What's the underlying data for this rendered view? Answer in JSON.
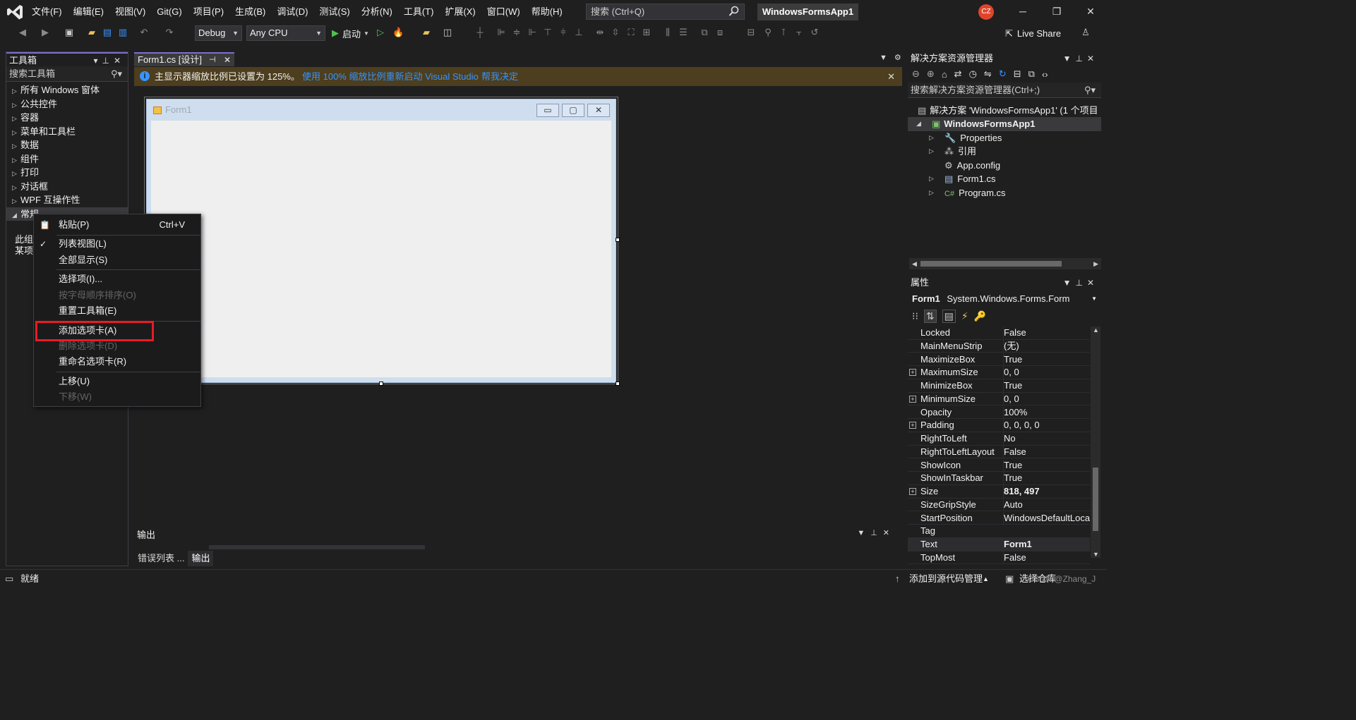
{
  "window": {
    "menu": [
      "文件(F)",
      "编辑(E)",
      "视图(V)",
      "Git(G)",
      "项目(P)",
      "生成(B)",
      "调试(D)",
      "测试(S)",
      "分析(N)",
      "工具(T)",
      "扩展(X)",
      "窗口(W)",
      "帮助(H)"
    ],
    "search_placeholder": "搜索 (Ctrl+Q)",
    "solution_name": "WindowsFormsApp1",
    "avatar": "CZ"
  },
  "toolbar": {
    "config": "Debug",
    "platform": "Any CPU",
    "start": "启动",
    "live_share": "Live Share"
  },
  "toolbox": {
    "title": "工具箱",
    "search": "搜索工具箱",
    "groups": [
      "所有 Windows 窗体",
      "公共控件",
      "容器",
      "菜单和工具栏",
      "数据",
      "组件",
      "打印",
      "对话框",
      "WPF 互操作性",
      "常规"
    ],
    "empty_line1": "此组",
    "empty_line2": "某项"
  },
  "document": {
    "tab": "Form1.cs [设计]",
    "info_message": "主显示器缩放比例已设置为 125%。",
    "info_link1": "使用 100% 缩放比例重新启动 Visual Studio",
    "info_link2": "帮我决定",
    "form_title": "Form1"
  },
  "context_menu": {
    "items": [
      {
        "label": "粘贴(P)",
        "shortcut": "Ctrl+V",
        "disabled": false
      },
      {
        "label": "列表视图(L)",
        "shortcut": "",
        "disabled": false,
        "checked": true
      },
      {
        "label": "全部显示(S)",
        "shortcut": "",
        "disabled": false
      },
      {
        "label": "选择项(I)...",
        "shortcut": "",
        "disabled": false
      },
      {
        "label": "按字母顺序排序(O)",
        "shortcut": "",
        "disabled": true
      },
      {
        "label": "重置工具箱(E)",
        "shortcut": "",
        "disabled": false
      },
      {
        "label": "添加选项卡(A)",
        "shortcut": "",
        "disabled": false,
        "highlighted": true
      },
      {
        "label": "删除选项卡(D)",
        "shortcut": "",
        "disabled": true
      },
      {
        "label": "重命名选项卡(R)",
        "shortcut": "",
        "disabled": false
      },
      {
        "label": "上移(U)",
        "shortcut": "",
        "disabled": false
      },
      {
        "label": "下移(W)",
        "shortcut": "",
        "disabled": true
      }
    ]
  },
  "solution_explorer": {
    "title": "解决方案资源管理器",
    "search": "搜索解决方案资源管理器(Ctrl+;)",
    "solution": "解决方案 'WindowsFormsApp1' (1 个项目",
    "project": "WindowsFormsApp1",
    "children": [
      "Properties",
      "引用",
      "App.config",
      "Form1.cs",
      "Program.cs"
    ]
  },
  "properties": {
    "title": "属性",
    "object_name": "Form1",
    "object_type": "System.Windows.Forms.Form",
    "rows": [
      {
        "name": "Locked",
        "value": "False"
      },
      {
        "name": "MainMenuStrip",
        "value": "(无)"
      },
      {
        "name": "MaximizeBox",
        "value": "True"
      },
      {
        "name": "MaximumSize",
        "value": "0, 0",
        "expandable": true
      },
      {
        "name": "MinimizeBox",
        "value": "True"
      },
      {
        "name": "MinimumSize",
        "value": "0, 0",
        "expandable": true
      },
      {
        "name": "Opacity",
        "value": "100%"
      },
      {
        "name": "Padding",
        "value": "0, 0, 0, 0",
        "expandable": true
      },
      {
        "name": "RightToLeft",
        "value": "No"
      },
      {
        "name": "RightToLeftLayout",
        "value": "False"
      },
      {
        "name": "ShowIcon",
        "value": "True"
      },
      {
        "name": "ShowInTaskbar",
        "value": "True"
      },
      {
        "name": "Size",
        "value": "818, 497",
        "expandable": true,
        "bold": true
      },
      {
        "name": "SizeGripStyle",
        "value": "Auto"
      },
      {
        "name": "StartPosition",
        "value": "WindowsDefaultLoca"
      },
      {
        "name": "Tag",
        "value": ""
      },
      {
        "name": "Text",
        "value": "Form1",
        "bold": true
      },
      {
        "name": "TopMost",
        "value": "False"
      }
    ]
  },
  "output": {
    "title": "输出",
    "tabs": [
      "错误列表 ...",
      "输出"
    ]
  },
  "statusbar": {
    "ready": "就绪",
    "source_control": "添加到源代码管理",
    "repo": "选择仓库",
    "watermark": "CSDN @Zhang_J"
  }
}
